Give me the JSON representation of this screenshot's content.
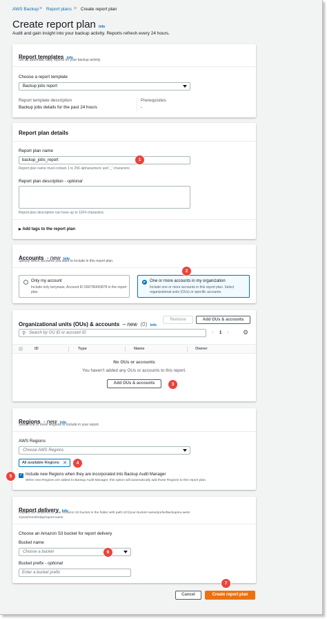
{
  "breadcrumb": {
    "items": [
      "AWS Backup",
      "Report plans",
      "Create report plan"
    ],
    "separator": ">"
  },
  "page": {
    "title": "Create report plan",
    "info": "Info",
    "subtitle": "Audit and gain insight into your backup activity. Reports refresh every 24 hours."
  },
  "report_templates": {
    "title": "Report templates",
    "info": "Info",
    "description": "Set up automatic daily reports on your backup activity.",
    "choose_label": "Choose a report template",
    "selected": "Backup jobs report",
    "template_desc_label": "Report template description",
    "template_desc_value": "Backup jobs details for the past 24 hours",
    "prereq_label": "Prerequisites",
    "prereq_value": "-"
  },
  "report_plan_details": {
    "title": "Report plan details",
    "name_label": "Report plan name",
    "name_value": "backup_jobs_report",
    "name_hint": "Report plan name must contain 1 to 256 alphanumeric and '_' characters",
    "desc_label": "Report plan description",
    "desc_optional": "- optional",
    "desc_hint": "Report plan description can have up to 1024 characters.",
    "tags_label": "Add tags to the report plan"
  },
  "accounts": {
    "title": "Accounts",
    "title_em": "- new",
    "info": "Info",
    "description": "Specify which accounts you want to include in this report plan.",
    "option1_label": "Only my account",
    "option1_desc": "Include only larryease, Account ID 599796493878 in the report plan.",
    "option2_label": "One or more accounts in my organization",
    "option2_desc": "Include one or more accounts in this report plan. Select organizational units (OUs) or specific accounts."
  },
  "ous": {
    "title": "Organizational units (OUs) & accounts",
    "title_em": "– new",
    "count": "(0)",
    "info": "Info",
    "remove_label": "Remove",
    "add_label": "Add OUs & accounts",
    "search_placeholder": "Search by OU ID or account ID",
    "page_number": "1",
    "columns": [
      "ID",
      "Type",
      "Name",
      "Owner"
    ],
    "empty_title": "No OUs or accounts",
    "empty_desc": "You haven't added any OUs or accounts to this report.",
    "empty_button": "Add OUs & accounts"
  },
  "regions": {
    "title": "Regions",
    "title_em": "- new",
    "info": "Info",
    "description": "Select one or more Regions to include in your report.",
    "aws_regions_label": "AWS Regions",
    "placeholder": "Choose AWS Regions",
    "token": "All available Regions",
    "checkbox_label": "Include new Regions when they are incorporated into Backup Audit Manager",
    "checkbox_desc": "When new Regions are added to Backup Audit Manager, this option will automatically add those Regions to this report plan."
  },
  "report_delivery": {
    "title": "Report delivery",
    "info": "Info",
    "description_line1": "Reports are delivered to your Amazon S3 bucket in the folder with path s3://your-bucket-name/prefix/Backup/eu-west-",
    "description_line2": "1/year/month/day/report-name",
    "choose_label": "Choose an Amazon S3 bucket for report delivery",
    "bucket_label": "Bucket name",
    "bucket_placeholder": "Choose a bucket",
    "prefix_label": "Bucket prefix",
    "prefix_optional": "- optional",
    "prefix_placeholder": "Enter a bucket prefix"
  },
  "footer": {
    "cancel_label": "Cancel",
    "create_label": "Create report plan"
  },
  "callouts": [
    "1",
    "2",
    "3",
    "4",
    "5",
    "6",
    "7"
  ],
  "colors": {
    "accent": "#0073bb",
    "primary_button": "#ec7211",
    "callout": "#e8453c",
    "background": "#f2f3f3"
  }
}
